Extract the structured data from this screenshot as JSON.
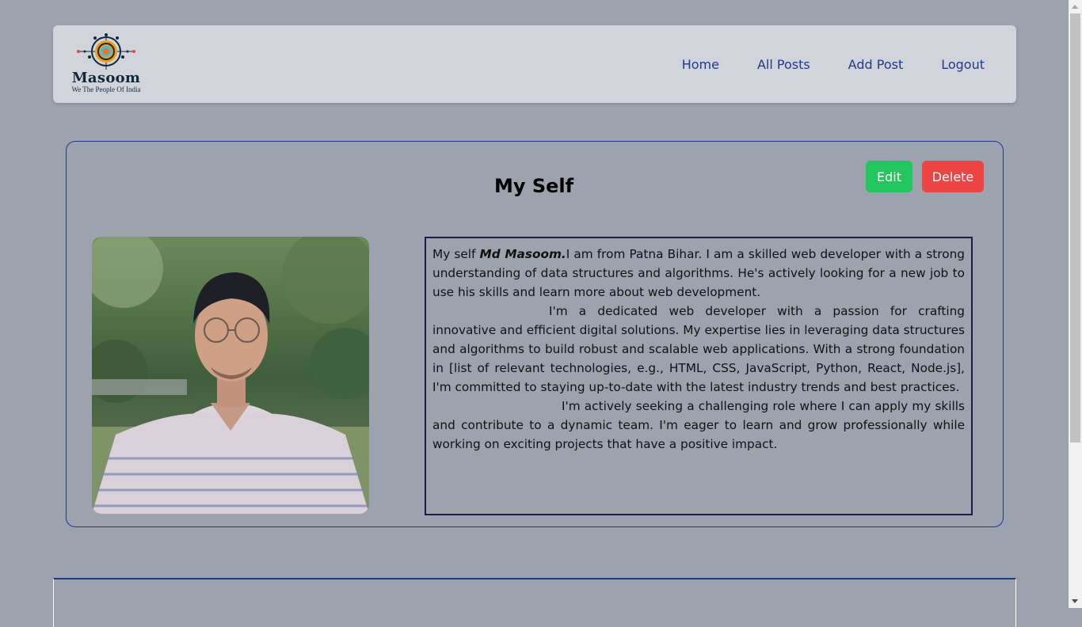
{
  "brand": {
    "name": "Masoom",
    "tagline": "We The People Of India"
  },
  "nav": {
    "items": [
      "Home",
      "All Posts",
      "Add Post",
      "Logout"
    ]
  },
  "post": {
    "title": "My Self",
    "edit_label": "Edit",
    "delete_label": "Delete",
    "image_alt": "Profile photo",
    "content": {
      "p1_prefix": "My self ",
      "p1_name": "Md Masoom.",
      "p1_rest": "I am from Patna Bihar. I am a skilled web developer with a strong understanding of data structures and algorithms. He's actively looking for a new job to use his skills and learn more about web development.",
      "p2": "I'm a dedicated web developer with a passion for crafting innovative and efficient digital solutions. My expertise lies in leveraging data structures and algorithms to build robust and scalable web applications. With a strong foundation in [list of relevant technologies, e.g., HTML, CSS, JavaScript, Python, React, Node.js], I'm committed to staying up-to-date with the latest industry trends and best practices.",
      "p3": "I'm actively seeking a challenging role where I can apply my skills and contribute to a dynamic team. I'm eager to learn and grow professionally while working on exciting projects that have a positive impact."
    }
  },
  "colors": {
    "background": "#9ca3af",
    "header": "#d1d5db",
    "link": "#1e3a8a",
    "edit": "#22c55e",
    "delete": "#ef4444"
  }
}
